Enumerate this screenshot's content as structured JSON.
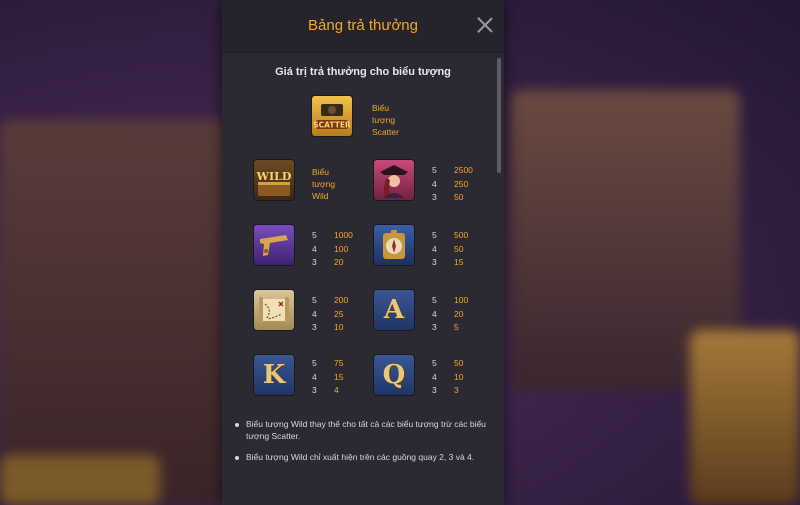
{
  "dialog": {
    "title": "Bảng trả thưởng",
    "subtitle": "Giá trị trả thưởng cho biểu tượng"
  },
  "scatter": {
    "icon": "scatter-symbol-icon",
    "icon_text": "SCATTER",
    "label_lines": [
      "Biểu",
      "tượng",
      "Scatter"
    ]
  },
  "wild": {
    "icon": "wild-symbol-icon",
    "icon_text": "WILD",
    "label_lines": [
      "Biểu",
      "tượng",
      "Wild"
    ]
  },
  "paytable": [
    {
      "symbol": "pirate-woman-icon",
      "glyph": "",
      "pays": [
        {
          "count": "5",
          "value": "2500"
        },
        {
          "count": "4",
          "value": "250"
        },
        {
          "count": "3",
          "value": "50"
        }
      ]
    },
    {
      "symbol": "pistol-icon",
      "glyph": "",
      "pays": [
        {
          "count": "5",
          "value": "1000"
        },
        {
          "count": "4",
          "value": "100"
        },
        {
          "count": "3",
          "value": "20"
        }
      ]
    },
    {
      "symbol": "compass-icon",
      "glyph": "",
      "pays": [
        {
          "count": "5",
          "value": "500"
        },
        {
          "count": "4",
          "value": "50"
        },
        {
          "count": "3",
          "value": "15"
        }
      ]
    },
    {
      "symbol": "treasure-map-icon",
      "glyph": "",
      "pays": [
        {
          "count": "5",
          "value": "200"
        },
        {
          "count": "4",
          "value": "25"
        },
        {
          "count": "3",
          "value": "10"
        }
      ]
    },
    {
      "symbol": "letter-a-icon",
      "glyph": "A",
      "pays": [
        {
          "count": "5",
          "value": "100"
        },
        {
          "count": "4",
          "value": "20"
        },
        {
          "count": "3",
          "value": "5"
        }
      ]
    },
    {
      "symbol": "letter-k-icon",
      "glyph": "K",
      "pays": [
        {
          "count": "5",
          "value": "75"
        },
        {
          "count": "4",
          "value": "15"
        },
        {
          "count": "3",
          "value": "4"
        }
      ]
    },
    {
      "symbol": "letter-q-icon",
      "glyph": "Q",
      "pays": [
        {
          "count": "5",
          "value": "50"
        },
        {
          "count": "4",
          "value": "10"
        },
        {
          "count": "3",
          "value": "3"
        }
      ]
    }
  ],
  "rules": [
    "Biểu tượng Wild thay thế cho tất cả các biểu tượng trừ các biểu tượng Scatter.",
    "Biểu tượng Wild chỉ xuất hiện trên các guồng quay 2, 3 và 4."
  ],
  "colors": {
    "accent": "#f5a623",
    "panel": "#2b2a33",
    "text": "#d8d6dd"
  }
}
